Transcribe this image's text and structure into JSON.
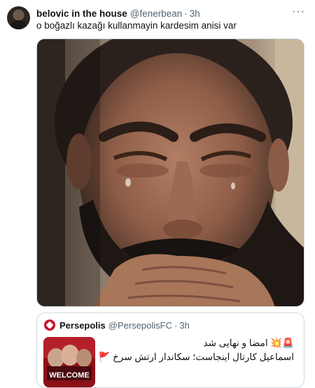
{
  "tweet": {
    "display_name": "belovic in the house",
    "handle": "@fenerbean",
    "separator": "·",
    "time": "3h",
    "more_icon": "ellipsis-icon",
    "text": "o boğazlı kazağı kullanmayin kardesim anisi var"
  },
  "quote": {
    "display_name": "Persepolis",
    "handle": "@PersepolisFC",
    "separator": "·",
    "time": "3h",
    "line1": "🚨💥 امضا و نهایی شد",
    "line2": "اسماعیل کارتال اینجاست؛ سکاندار ارتش سرخ 🚩",
    "thumbnail_text": "WELCOME"
  },
  "colors": {
    "text": "#0f1419",
    "secondary": "#536471",
    "border": "#cfd9de",
    "brand_red": "#c8102e"
  }
}
